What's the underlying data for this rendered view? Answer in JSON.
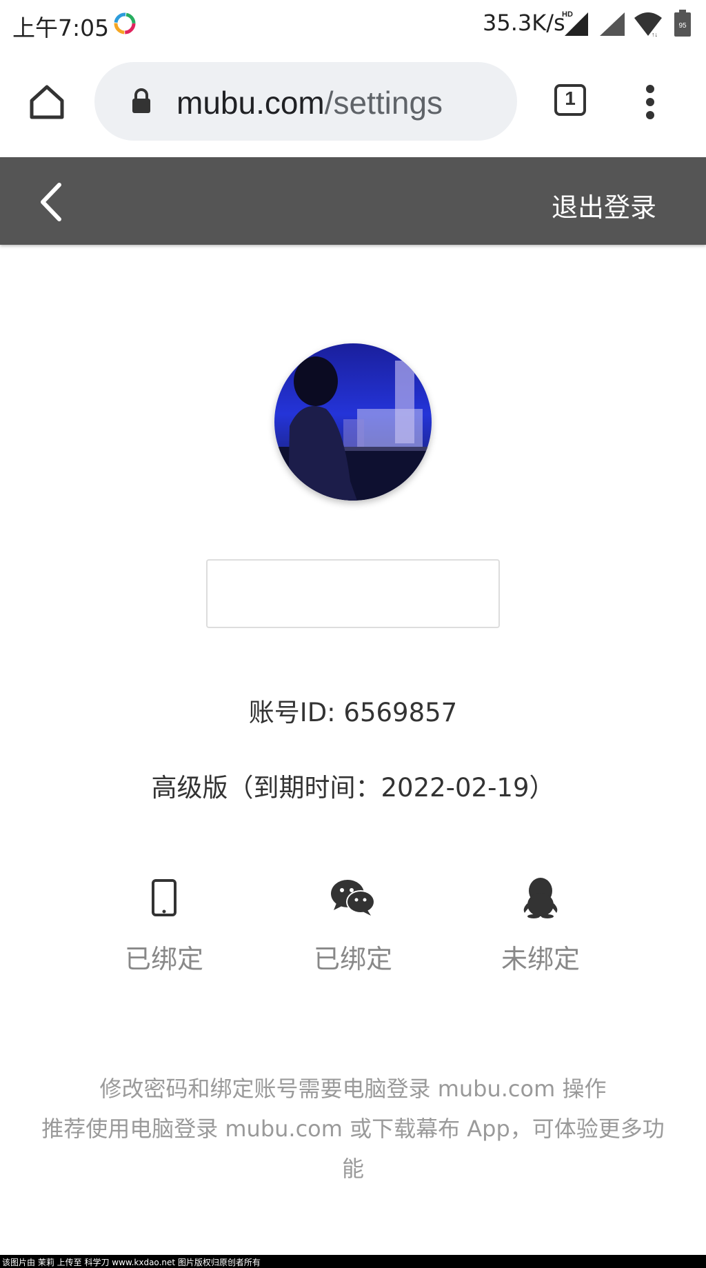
{
  "status_bar": {
    "time": "上午7:05",
    "net_speed": "35.3K/s",
    "hd_label": "HD",
    "battery": "95"
  },
  "browser": {
    "url_host": "mubu.com",
    "url_path": "/settings",
    "tab_count": "1"
  },
  "header": {
    "logout_label": "退出登录"
  },
  "profile": {
    "account_id": "账号ID: 6569857",
    "plan": "高级版（到期时间：2022-02-19）"
  },
  "bindings": [
    {
      "icon": "phone-icon",
      "label": "已绑定"
    },
    {
      "icon": "wechat-icon",
      "label": "已绑定"
    },
    {
      "icon": "qq-icon",
      "label": "未绑定"
    }
  ],
  "footer": {
    "line1": "修改密码和绑定账号需要电脑登录 mubu.com 操作",
    "line2": "推荐使用电脑登录 mubu.com 或下载幕布 App，可体验更多功能"
  },
  "watermark": "该图片由 茉莉 上传至 科学刀 www.kxdao.net 图片版权归原创者所有",
  "colors": {
    "header_bg": "#555555",
    "label_gray": "#888888",
    "footer_gray": "#9a9a9a",
    "url_bg": "#eef0f3"
  }
}
